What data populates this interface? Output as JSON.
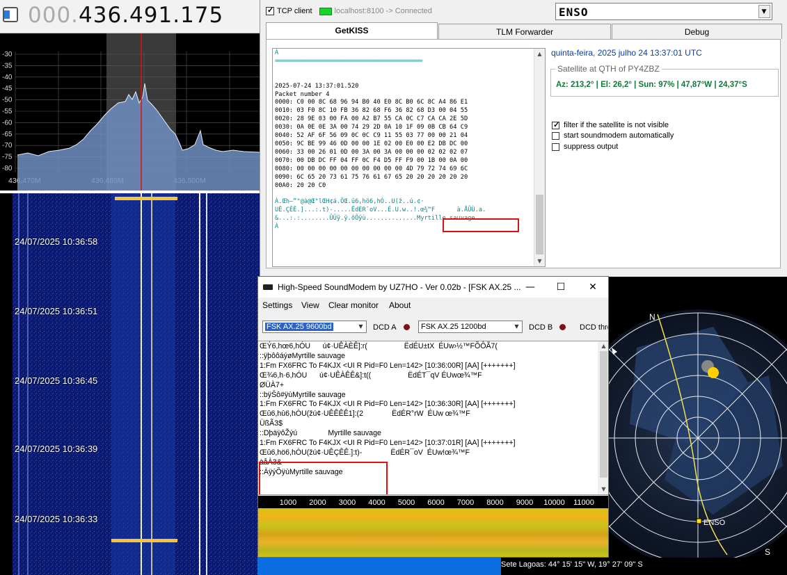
{
  "sdr": {
    "frequency_dim": "000.",
    "frequency_main": "436.491.175",
    "db_ticks": [
      "-30",
      "-35",
      "-40",
      "-45",
      "-50",
      "-55",
      "-60",
      "-65",
      "-70",
      "-75",
      "-80"
    ],
    "freq_ticks": [
      "436,470M",
      "436,485M",
      "436,500M"
    ],
    "waterfall_timestamps": [
      "24/07/2025 10:36:58",
      "24/07/2025 10:36:51",
      "24/07/2025 10:36:45",
      "24/07/2025 10:36:39",
      "24/07/2025 10:36:33"
    ]
  },
  "getkiss": {
    "tcp_client_label": "TCP client",
    "tcp_client_checked": true,
    "connection_status": "localhost:8100 -> Connected",
    "satellite_selected": "ENSO",
    "tabs": [
      "GetKISS",
      "TLM Forwarder",
      "Debug"
    ],
    "active_tab": "GetKISS",
    "packet_lines": [
      {
        "text": "À",
        "cls": "teal"
      },
      {
        "text": "==================================================",
        "cls": "sep"
      },
      {
        "text": "",
        "cls": ""
      },
      {
        "text": "",
        "cls": ""
      },
      {
        "text": "2025-07-24 13:37:01.520",
        "cls": ""
      },
      {
        "text": "Packet number 4",
        "cls": ""
      },
      {
        "text": "0000: C0 00 8C 68 96 94 B0 40 E0 8C B0 6C 8C A4 86 E1",
        "cls": ""
      },
      {
        "text": "0010: 03 F0 8C 10 FB 36 82 68 F6 36 82 68 D3 00 04 55",
        "cls": ""
      },
      {
        "text": "0020: 28 9E 03 00 FA 00 A2 B7 55 CA 0C C7 CA CA 2E 5D",
        "cls": ""
      },
      {
        "text": "0030: 0A 0E 0E 3A 00 74 29 2D 0A 10 1F 09 0B CB 64 C9",
        "cls": ""
      },
      {
        "text": "0040: 52 AF 6F 56 09 0C 0C C9 11 55 03 77 00 00 21 04",
        "cls": ""
      },
      {
        "text": "0050: 9C BE 99 46 0D 00 00 1E 02 00 E0 00 E2 DB DC 00",
        "cls": ""
      },
      {
        "text": "0060: 33 00 26 01 0D 00 3A 00 3A 00 00 00 02 02 02 07",
        "cls": ""
      },
      {
        "text": "0070: 00 DB DC FF 04 FF 0C F4 D5 FF F9 00 1B 00 0A 00",
        "cls": ""
      },
      {
        "text": "0080: 00 00 00 00 00 00 00 00 00 00 4D 79 72 74 69 6C",
        "cls": ""
      },
      {
        "text": "0090: 6C 65 20 73 61 75 76 61 67 65 20 20 20 20 20 20",
        "cls": ""
      },
      {
        "text": "00A0: 20 20 C0",
        "cls": ""
      },
      {
        "text": "",
        "cls": ""
      },
      {
        "text": "À.Œh–”°@à@Œ°lŒH¢á.ÕŒ.û6,hö6,hÓ..U(ž..ú.¢·",
        "cls": "teal"
      },
      {
        "text": "UÊ.ÇÊÊ.]...:.t)-.....ËdÉR¯oV...É.U.w..!.œ¾™F      à.ÅÛÙ.a.",
        "cls": "teal"
      },
      {
        "text": "&...:.:........ÛÜÿ.ÿ.ôÕÿù..............Myrtille sauvage",
        "cls": "teal"
      },
      {
        "text": "À",
        "cls": "teal"
      }
    ],
    "datetime": "quinta-feira, 2025 julho 24 13:37:01 UTC",
    "qth_title": "Satellite at QTH of PY4ZBZ",
    "qth_values": "Az: 213,2° | El: 26,2° | Sun: 97% | 47,87°W | 24,37°S",
    "options": [
      {
        "label": "filter if the satellite is not visible",
        "checked": true
      },
      {
        "label": "start soundmodem automatically",
        "checked": false
      },
      {
        "label": "suppress output",
        "checked": false
      }
    ]
  },
  "soundmodem": {
    "title": "High-Speed SoundModem by UZ7HO - Ver 0.02b - [FSK AX.25 ...",
    "menu": [
      "Settings",
      "View",
      "Clear monitor",
      "About"
    ],
    "modem_a": "FSK AX.25 9600bd",
    "dcd_a": "DCD A",
    "modem_b": "FSK AX.25 1200bd",
    "dcd_b": "DCD B",
    "dcd_thr": "DCD thre",
    "monitor_lines": [
      "ŒÝ6,hœ6,hÓU      ú¢·UÊÀÈÊ]:r(                  ËdÉU±tX  ÉUw›½™FÕÔÃ7(",
      "::ÿþôôáýøMyrtille sauvage",
      "1:Fm FX6FRC To F4KJX <UI R Pid=F0 Len=142> [10:36:00R] [AA] [+++++++]",
      "Œ¾6,h·6,hÓU      ú¢·UÊÀÊÊ&]:t((                  ËdÉT¯qV ÉUwœ¾™F",
      "ØÜÀ7+",
      "::bÿŠô#ÿùMyrtille sauvage",
      "1:Fm FX6FRC To F4KJX <UI R Pid=F0 Len=142> [10:36:30R] [AA] [+++++++]",
      "Œû6,hû6,hÓU(žú¢·UÊÊÊÊ1]:(2              ËdÉR°rW  ÉUw œ¾™F",
      "ÜßÃ3$",
      "::DþäÿôŽýú               Myrtille sauvage",
      "1:Fm FX6FRC To F4KJX <UI R Pid=F0 Len=142> [10:37:01R] [AA] [+++++++]",
      "Œû6,hö6,hÓU(žú¢·UÊÇÊÊ.]:t)-              ËdÉR¯oV  ÉUw!œ¾™F",
      "àåÀ3&",
      "::ÄÿýÕÿùMyrtille sauvage"
    ],
    "spectrum_ticks": [
      "1000",
      "2000",
      "3000",
      "4000",
      "5000",
      "6000",
      "7000",
      "8000",
      "9000",
      "10000",
      "11000",
      "1"
    ]
  },
  "skymap": {
    "north": "N",
    "south": "S",
    "satellite_label": "ENSO",
    "location": "Sete Lagoas: 44° 15' 15\" W, 19° 27' 09\" S"
  }
}
